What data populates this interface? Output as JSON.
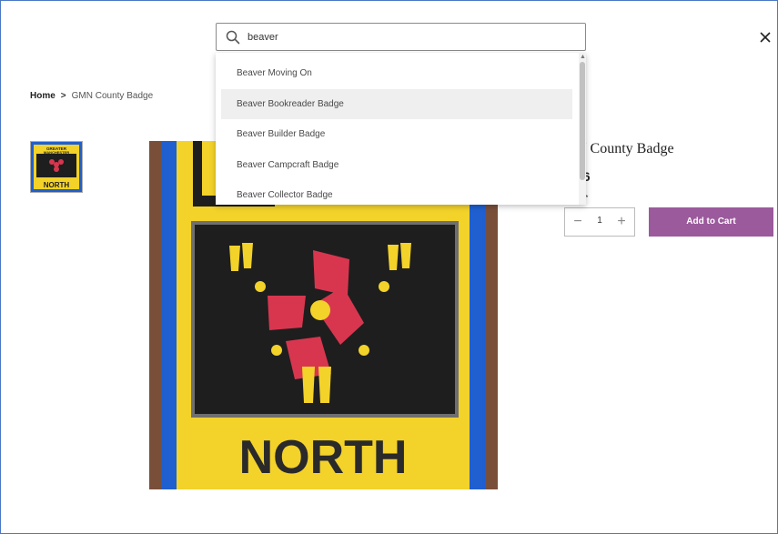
{
  "search": {
    "value": "beaver",
    "placeholder": ""
  },
  "dropdown": {
    "items": [
      {
        "label": "Beaver Moving On"
      },
      {
        "label": "Beaver Bookreader Badge"
      },
      {
        "label": "Beaver Builder Badge"
      },
      {
        "label": "Beaver Campcraft Badge"
      },
      {
        "label": "Beaver Collector Badge"
      }
    ],
    "highlighted_index": 1
  },
  "breadcrumb": {
    "home": "Home",
    "separator": ">",
    "current": "GMN County Badge"
  },
  "product": {
    "title": "N County Badge",
    "price": "76",
    "qty_label": "ity *",
    "quantity": "1",
    "add_to_cart": "Add to Cart",
    "badge_text": "NORTH",
    "thumb_top_text": "GREATER MANCHESTER",
    "thumb_bottom_text": "NORTH"
  },
  "icons": {
    "search": "search-icon",
    "close": "close-icon",
    "minus": "minus-icon",
    "plus": "plus-icon"
  },
  "colors": {
    "accent": "#9b5a9c",
    "badge_blue": "#1f5fd0",
    "badge_yellow": "#f3d22a",
    "badge_red": "#d8364f"
  }
}
